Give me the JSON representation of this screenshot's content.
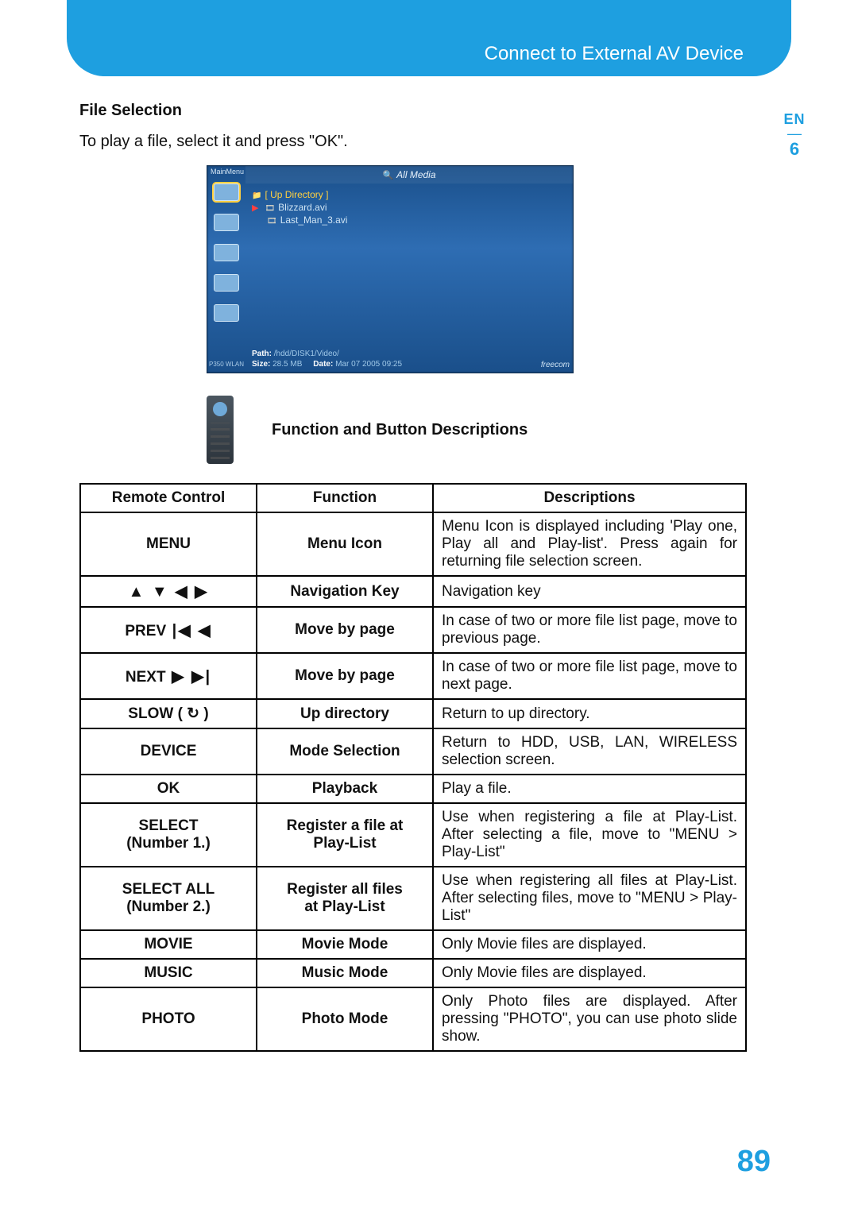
{
  "banner_title": "Connect to External AV Device",
  "lang": "EN",
  "chapter": "6",
  "file_selection_heading": "File Selection",
  "file_selection_text": "To play a file, select it and press \"OK\".",
  "screenshot": {
    "sidebar_label": "MainMenu",
    "header": "All Media",
    "rows": {
      "up": "[ Up Directory ]",
      "f1": "Blizzard.avi",
      "f2": "Last_Man_3.avi"
    },
    "footer_path_label": "Path:",
    "footer_path": "/hdd/DISK1/Video/",
    "footer_size_label": "Size:",
    "footer_size": "28.5 MB",
    "footer_date_label": "Date:",
    "footer_date": "Mar 07 2005 09:25",
    "brand": "freecom",
    "device_tag": "P350 WLAN"
  },
  "func_heading": "Function and Button Descriptions",
  "table": {
    "headers": {
      "rc": "Remote Control",
      "fn": "Function",
      "desc": "Descriptions"
    },
    "rows": [
      {
        "rc": "MENU",
        "rc_glyph": "",
        "fn": "Menu Icon",
        "desc": "Menu Icon is displayed including 'Play one, Play all and Play-list'. Press again for returning file selection screen."
      },
      {
        "rc": "",
        "rc_glyph": "▲ ▼ ◀ ▶",
        "fn": "Navigation Key",
        "desc": "Navigation key"
      },
      {
        "rc": "PREV",
        "rc_glyph": " |◀ ◀",
        "fn": "Move by page",
        "desc": "In case of two or more file list page, move to previous page."
      },
      {
        "rc": "NEXT",
        "rc_glyph": " ▶ ▶|",
        "fn": "Move by page",
        "desc": "In case of two or more file list page, move to next page."
      },
      {
        "rc": "SLOW ( ↻ )",
        "rc_glyph": "",
        "fn": "Up directory",
        "desc": "Return to up directory."
      },
      {
        "rc": "DEVICE",
        "rc_glyph": "",
        "fn": "Mode Selection",
        "desc": "Return to HDD, USB, LAN, WIRELESS selection screen."
      },
      {
        "rc": "OK",
        "rc_glyph": "",
        "fn": "Playback",
        "desc": "Play a file."
      },
      {
        "rc": "SELECT",
        "rc_sub": "(Number 1.)",
        "rc_glyph": "",
        "fn": "Register a file at\nPlay-List",
        "desc": "Use when registering a file at Play-List. After selecting a file, move to \"MENU > Play-List\""
      },
      {
        "rc": "SELECT ALL",
        "rc_sub": "(Number 2.)",
        "rc_glyph": "",
        "fn": "Register all files\nat Play-List",
        "desc": "Use when registering all files at Play-List. After selecting files, move to \"MENU > Play-List\""
      },
      {
        "rc": "MOVIE",
        "rc_glyph": "",
        "fn": "Movie Mode",
        "desc": "Only Movie files are displayed."
      },
      {
        "rc": "MUSIC",
        "rc_glyph": "",
        "fn": "Music Mode",
        "desc": "Only Movie files are displayed."
      },
      {
        "rc": "PHOTO",
        "rc_glyph": "",
        "fn": "Photo Mode",
        "desc": "Only Photo files are displayed. After pressing \"PHOTO\", you can use photo slide show."
      }
    ]
  },
  "page_number": "89"
}
